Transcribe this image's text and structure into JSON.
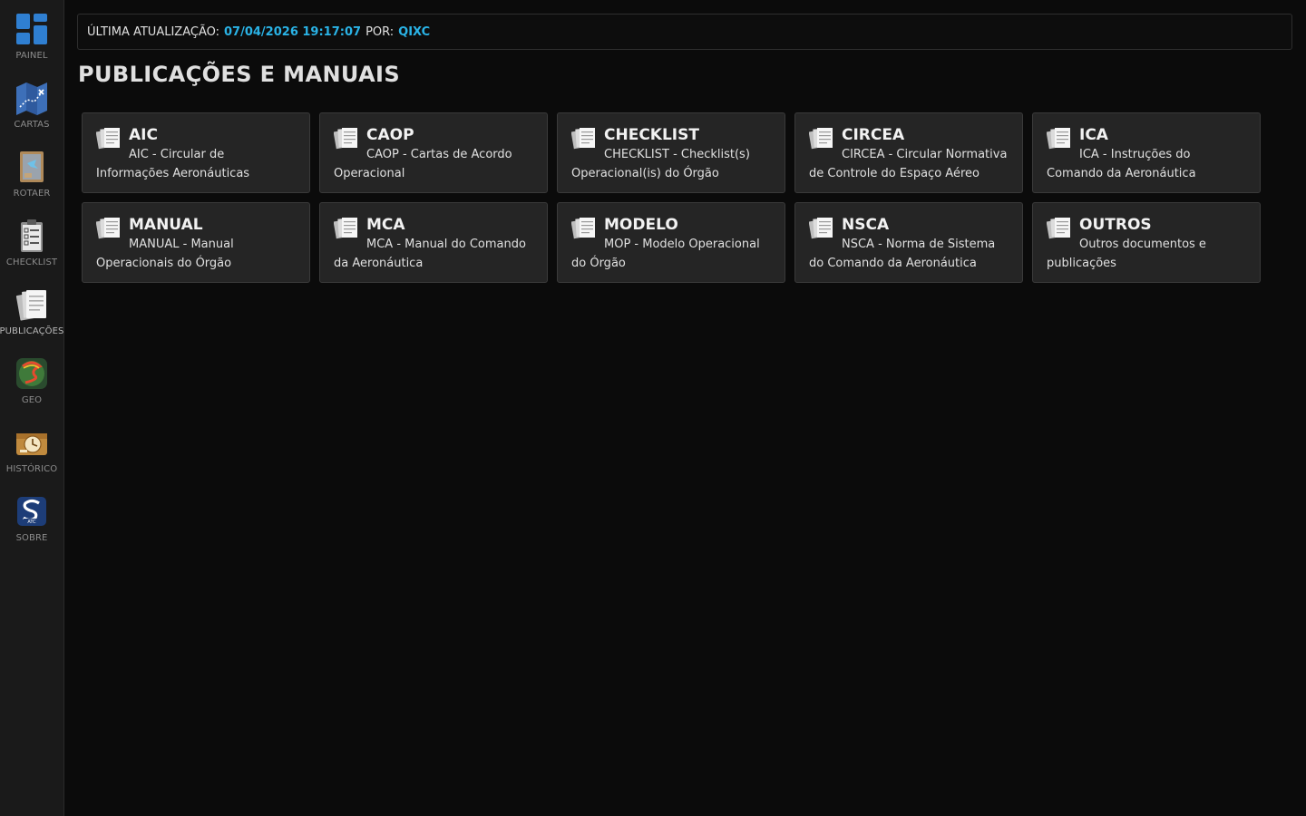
{
  "sidebar": {
    "items": [
      {
        "label": "PAINEL",
        "icon": "dashboard-icon"
      },
      {
        "label": "CARTAS",
        "icon": "map-icon"
      },
      {
        "label": "ROTAER",
        "icon": "rotaer-icon"
      },
      {
        "label": "CHECKLIST",
        "icon": "checklist-icon"
      },
      {
        "label": "PUBLICAÇÕES",
        "icon": "publications-icon"
      },
      {
        "label": "GEO",
        "icon": "geo-icon"
      },
      {
        "label": "HISTÓRICO",
        "icon": "history-icon"
      },
      {
        "label": "SOBRE",
        "icon": "about-icon"
      }
    ]
  },
  "status": {
    "updated_label": "ÚLTIMA ATUALIZAÇÃO:",
    "updated_value": "07/04/2026 19:17:07",
    "by_label": "POR:",
    "by_value": "QIXC"
  },
  "page": {
    "title": "PUBLICAÇÕES E MANUAIS"
  },
  "cards": [
    {
      "title": "AIC",
      "desc": "AIC - Circular de Informações Aeronáuticas"
    },
    {
      "title": "CAOP",
      "desc": "CAOP - Cartas de Acordo Operacional"
    },
    {
      "title": "CHECKLIST",
      "desc": "CHECKLIST - Checklist(s) Operacional(is) do Órgão"
    },
    {
      "title": "CIRCEA",
      "desc": "CIRCEA - Circular Normativa de Controle do Espaço Aéreo"
    },
    {
      "title": "ICA",
      "desc": "ICA - Instruções do Comando da Aeronáutica"
    },
    {
      "title": "MANUAL",
      "desc": "MANUAL - Manual Operacionais do Órgão"
    },
    {
      "title": "MCA",
      "desc": "MCA - Manual do Comando da Aeronáutica"
    },
    {
      "title": "MODELO",
      "desc": "MOP - Modelo Operacional do Órgão"
    },
    {
      "title": "NSCA",
      "desc": "NSCA - Norma de Sistema do Comando da Aeronáutica"
    },
    {
      "title": "OUTROS",
      "desc": "Outros documentos e publicações"
    }
  ],
  "colors": {
    "accent": "#2ab3e6",
    "background": "#0b0b0b",
    "card": "#252525"
  }
}
